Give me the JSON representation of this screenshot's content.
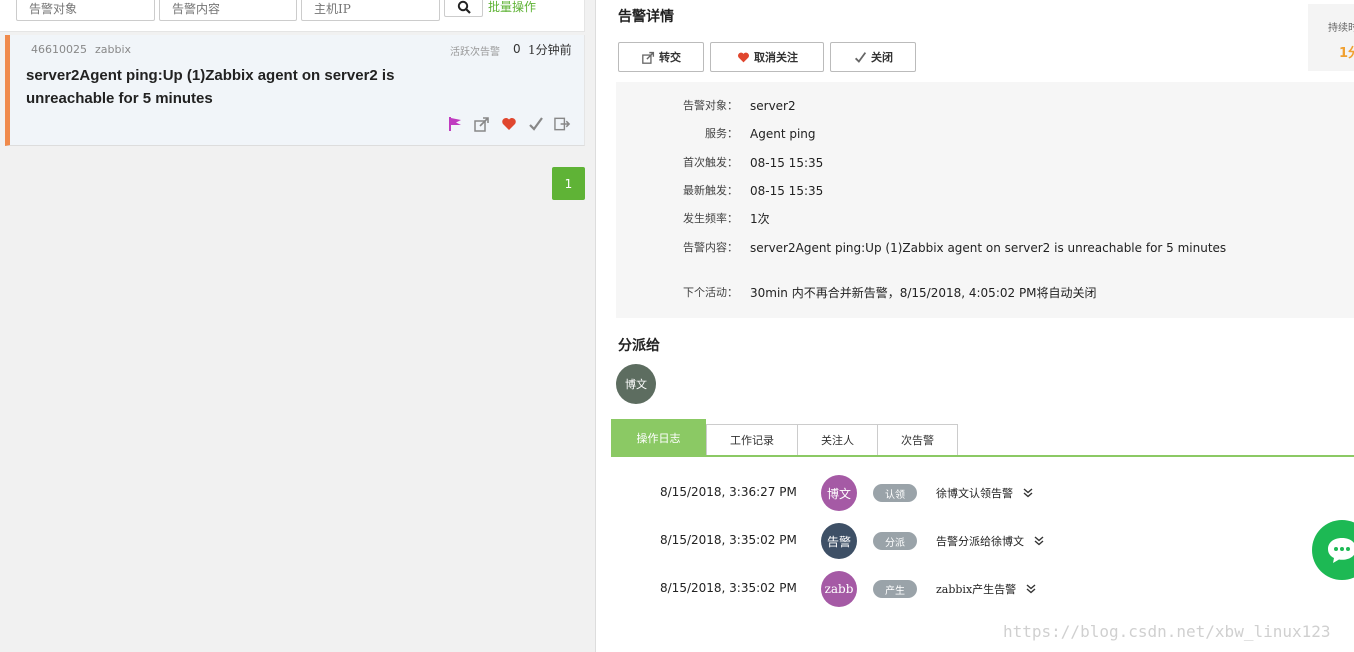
{
  "filters": {
    "target_placeholder": "告警对象",
    "content_placeholder": "告警内容",
    "ip_placeholder": "主机IP",
    "batch_label": "批量操作"
  },
  "alert_card": {
    "id": "46610025",
    "source": "zabbix",
    "active_label": "活跃次告警",
    "active_count": "0",
    "time_ago": "1分钟前",
    "title": "server2Agent ping:Up (1)Zabbix agent on server2 is unreachable for 5 minutes",
    "accent_color": "#f08a4b"
  },
  "pagination": {
    "current": "1"
  },
  "detail": {
    "title": "告警详情",
    "duration_label": "持续时",
    "duration_value": "1分",
    "actions": {
      "forward": "转交",
      "unfollow": "取消关注",
      "close": "关闭"
    },
    "info": [
      {
        "label": "告警对象：",
        "value": "server2"
      },
      {
        "label": "服务：",
        "value": "Agent ping"
      },
      {
        "label": "首次触发：",
        "value": "08-15 15:35"
      },
      {
        "label": "最新触发：",
        "value": "08-15 15:35"
      },
      {
        "label": "发生频率：",
        "value": "1次"
      },
      {
        "label": "告警内容：",
        "value": "server2Agent ping:Up (1)Zabbix agent on server2 is unreachable for 5 minutes"
      },
      {
        "label": "下个活动：",
        "value": "30min 内不再合并新告警，8/15/2018, 4:05:02 PM将自动关闭"
      }
    ]
  },
  "assign": {
    "title": "分派给",
    "avatar_text": "博文"
  },
  "tabs": [
    {
      "label": "操作日志"
    },
    {
      "label": "工作记录"
    },
    {
      "label": "关注人"
    },
    {
      "label": "次告警"
    }
  ],
  "logs": [
    {
      "time": "8/15/2018, 3:36:27 PM",
      "avatar": "博文",
      "avatar_color": "#a55aa5",
      "tag": "认领",
      "text": "徐博文认领告警"
    },
    {
      "time": "8/15/2018, 3:35:02 PM",
      "avatar": "告警",
      "avatar_color": "#3e5066",
      "tag": "分派",
      "text": "告警分派给徐博文"
    },
    {
      "time": "8/15/2018, 3:35:02 PM",
      "avatar": "zabb",
      "avatar_color": "#a55aa5",
      "tag": "产生",
      "text": "zabbix产生告警"
    }
  ],
  "watermark": "https://blog.csdn.net/xbw_linux123",
  "colors": {
    "green": "#5fb336",
    "tab_green": "#8bc964",
    "chat_green": "#1db954"
  }
}
